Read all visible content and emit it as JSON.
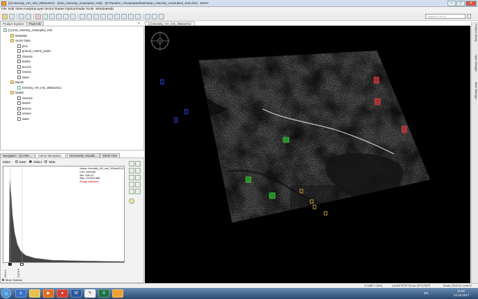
{
  "window": {
    "title": "[1] Intensity_HH_mst_30Mar2012 - [train_intensity_resampled_msk] - [D:\\Tandem_x\\resampled\\train\\train_intensity_resampled_msk.dim] - SNAP",
    "controls": [
      "–",
      "□",
      "×"
    ]
  },
  "menu": [
    "File",
    "Edit",
    "View",
    "Analysis",
    "Layer",
    "Vector",
    "Raster",
    "Optical",
    "Radar",
    "Tools",
    "Window",
    "Help"
  ],
  "search": {
    "placeholder": "Search (Ctrl+I)"
  },
  "product_panel": {
    "tabs": [
      "Product Explorer",
      "Pixel Info"
    ],
    "tree": [
      {
        "label": "[1] train_intensity_resampled_msk",
        "level": 0,
        "icon": "product"
      },
      {
        "label": "Metadata",
        "level": 1,
        "icon": "folder"
      },
      {
        "label": "Vector Data",
        "level": 1,
        "icon": "folder"
      },
      {
        "label": "pins",
        "level": 2,
        "icon": "vec"
      },
      {
        "label": "ground_control_points",
        "level": 2,
        "icon": "vec"
      },
      {
        "label": "closeice",
        "level": 2,
        "icon": "vec"
      },
      {
        "label": "fastice",
        "level": 2,
        "icon": "vec"
      },
      {
        "label": "leveice",
        "level": 2,
        "icon": "vec"
      },
      {
        "label": "newice",
        "level": 2,
        "icon": "vec"
      },
      {
        "label": "water",
        "level": 2,
        "icon": "vec"
      },
      {
        "label": "Bands",
        "level": 1,
        "icon": "folder"
      },
      {
        "label": "Intensity_HH_mst_30Mar2012",
        "level": 2,
        "icon": "band"
      },
      {
        "label": "Masks",
        "level": 1,
        "icon": "folder"
      },
      {
        "label": "closeice",
        "level": 2,
        "icon": "vec"
      },
      {
        "label": "fastice",
        "level": 2,
        "icon": "vec"
      },
      {
        "label": "leveice",
        "level": 2,
        "icon": "vec"
      },
      {
        "label": "newice",
        "level": 2,
        "icon": "vec"
      },
      {
        "label": "water",
        "level": 2,
        "icon": "vec"
      }
    ]
  },
  "bottom_panel": {
    "tabs": [
      "Navigation - [1] Inten...",
      "Colour Manipulati...",
      "Uncertainty Visualis...",
      "World View"
    ],
    "editor_label": "Editor:",
    "editor_options": [
      "Basic",
      "Sliders",
      "Table"
    ],
    "editor_selected": "Sliders",
    "info": {
      "name": "Name: Intensity_HH_mst_30Mar2012",
      "unit": "Unit: intensity",
      "min": "Min: 596.15",
      "max": "Max: 247615.688",
      "warning": "Rough statistics!"
    },
    "axis_labels": [
      "2014.4",
      "21675.5"
    ],
    "more_options": "More Options"
  },
  "view_tab": "[1] Intensity_HH_mst_30Mar2012",
  "right_tabs": [
    "Product Library",
    "Layer Manager",
    "Mask Manager"
  ],
  "status": {
    "xy": "X  1185  Y  4410",
    "latlon": "Lat  64°57'57\"N  Lon  24°11'50\"E",
    "zoom": "Zoom  1513.5:1  Level  2"
  },
  "taskbar": {
    "lang": "EN",
    "time": "11:52",
    "date": "24.10.2017"
  },
  "colors": {
    "fastice": "#22aa22",
    "closeice": "#cc3333",
    "leveice": "#cc9933",
    "water": "#2244cc"
  }
}
